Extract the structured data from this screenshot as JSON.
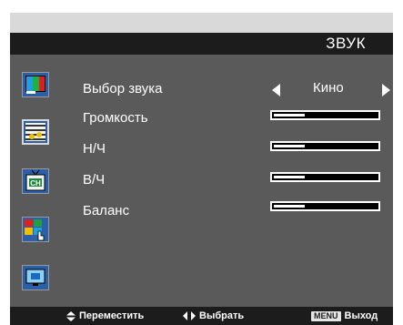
{
  "menu": {
    "title": "ЗВУК"
  },
  "sidebar": {
    "icons": [
      {
        "name": "picture-menu-icon"
      },
      {
        "name": "sound-menu-icon"
      },
      {
        "name": "channel-menu-icon"
      },
      {
        "name": "features-menu-icon"
      },
      {
        "name": "screen-menu-icon"
      }
    ]
  },
  "settings": {
    "sound_mode": {
      "label": "Выбор звука",
      "value": "Кино"
    },
    "volume": {
      "label": "Громкость",
      "level_pct": 30
    },
    "bass": {
      "label": "Н/Ч",
      "level_pct": 30
    },
    "treble": {
      "label": "В/Ч",
      "level_pct": 30
    },
    "balance": {
      "label": "Баланс",
      "level_pct": 30
    }
  },
  "footer": {
    "move": {
      "icon": "up-down-arrows-icon",
      "label": "Переместить"
    },
    "select": {
      "icon": "left-right-arrows-icon",
      "label": "Выбрать"
    },
    "exit": {
      "key": "MENU",
      "label": "Выход"
    }
  },
  "colors": {
    "panel": "#5a5a5a",
    "bar": "#1c1c1c",
    "accent_blue": "#2b5fa8"
  }
}
